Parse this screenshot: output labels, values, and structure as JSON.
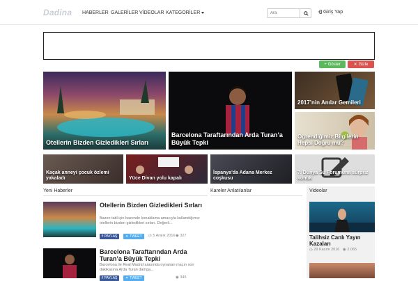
{
  "header": {
    "logo_text": "Dadina",
    "nav": [
      {
        "label": "HABERLER"
      },
      {
        "label": "GALERİLER"
      },
      {
        "label": "VİDEOLAR"
      },
      {
        "label": "KATEGORİLER"
      }
    ],
    "search_placeholder": "Ara",
    "login_label": "Giriş Yap"
  },
  "ad": {
    "show_label": "Göster",
    "hide_label": "Gizle",
    "show_color": "#5cb85c",
    "hide_color": "#d9534f"
  },
  "featured": [
    {
      "title": "Otellerin Bizden Gizledikleri Sırları"
    },
    {
      "title": "Barcelona Taraftarından Arda Turan’a Büyük Tepki"
    },
    {
      "title": "2017’nin Anılar Gemileri"
    },
    {
      "title": "Öğrendiğimiz Bilgilerin Hepsi Doğru mu?"
    }
  ],
  "small_tiles": [
    {
      "title": "Kaçak anneyi çocuk özlemi yakaladı"
    },
    {
      "title": "Yüce Divan yolu kapalı"
    },
    {
      "title": "İspanya'da Adana Merkez coşkusu"
    },
    {
      "title": "7. Dünya Su Forumuna sürpriz konuk"
    }
  ],
  "sections": {
    "news": "Yeni Haberler",
    "caricatures": "Kareler Anlatılanlar",
    "videos": "Videolar"
  },
  "articles": [
    {
      "title": "Otellerin Bizden Gizledikleri Sırları",
      "desc": "Bazen tatil için bazende konaklama amacıyla kullandığımız otellerin bizden gizledikleri sırları. Değerli...",
      "share": "PAYLAŞ",
      "tweet": "TWEET",
      "date": "5 Aralık 2016",
      "views": "327"
    },
    {
      "title": "Barcelona Taraftarından Arda Turan’a Büyük Tepki",
      "desc": "Barcelona ile Real Madrid arasında oynanan maçın son dakikasına Arda Turan damga...",
      "share": "PAYLAŞ",
      "tweet": "TWEET",
      "date": "",
      "views": "345"
    }
  ],
  "video": {
    "title": "Talihsiz Canlı Yayın Kazaları",
    "date": "29 Kasım 2016",
    "views": "2.065"
  },
  "colors": {
    "share_fb": "#3b5998",
    "share_tw": "#55acee",
    "border": "#e3e3e3"
  }
}
